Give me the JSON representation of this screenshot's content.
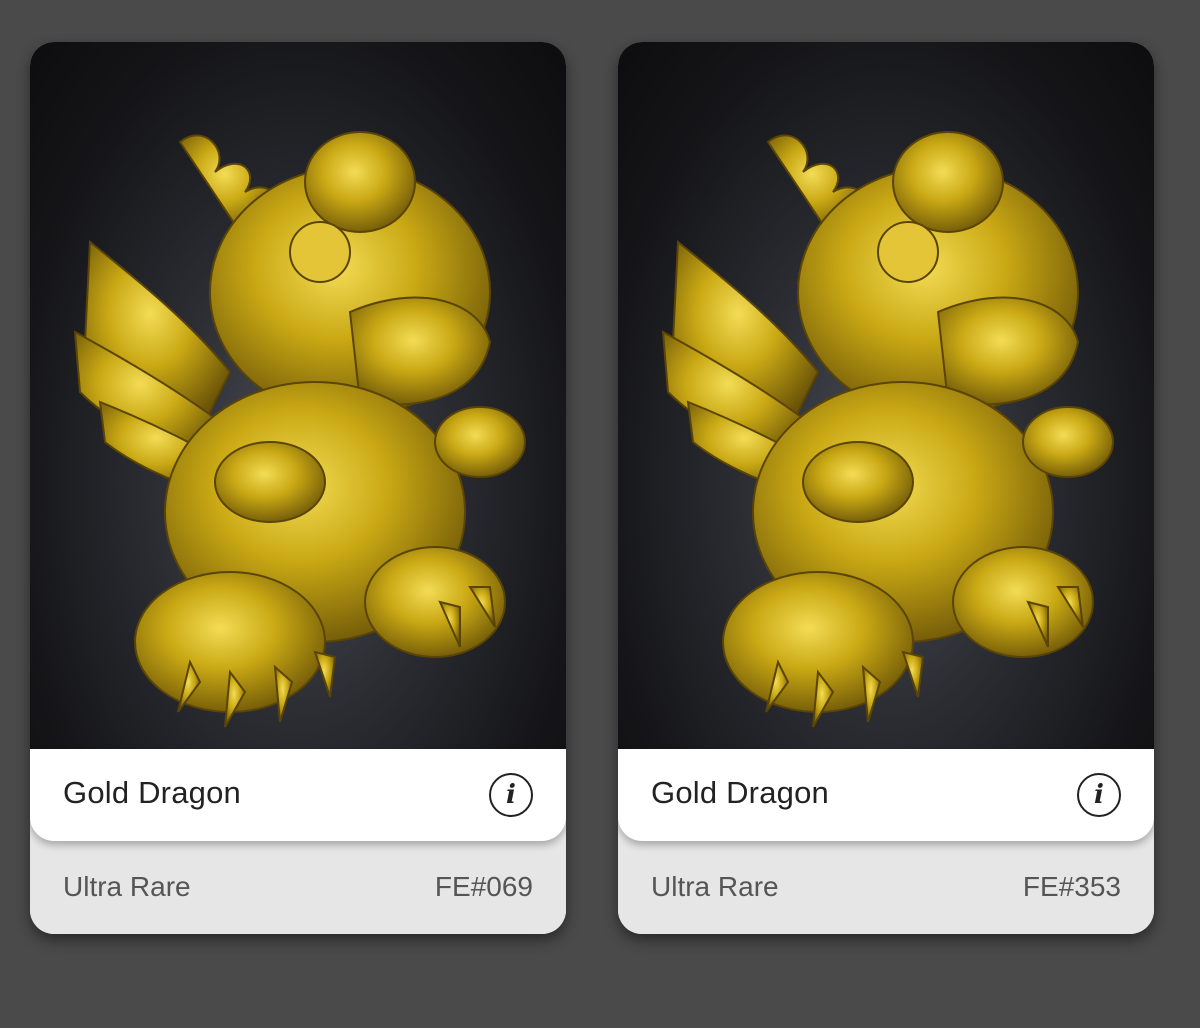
{
  "cards": [
    {
      "name": "Gold Dragon",
      "rarity": "Ultra Rare",
      "serial": "FE#069",
      "info_icon": "i",
      "image_subject": "gold-dragon-figurine"
    },
    {
      "name": "Gold Dragon",
      "rarity": "Ultra Rare",
      "serial": "FE#353",
      "info_icon": "i",
      "image_subject": "gold-dragon-figurine"
    }
  ],
  "colors": {
    "page_bg": "#4a4a4a",
    "gold": "#c9a814",
    "card_name_bg": "#ffffff",
    "card_meta_bg": "#e6e6e6"
  }
}
